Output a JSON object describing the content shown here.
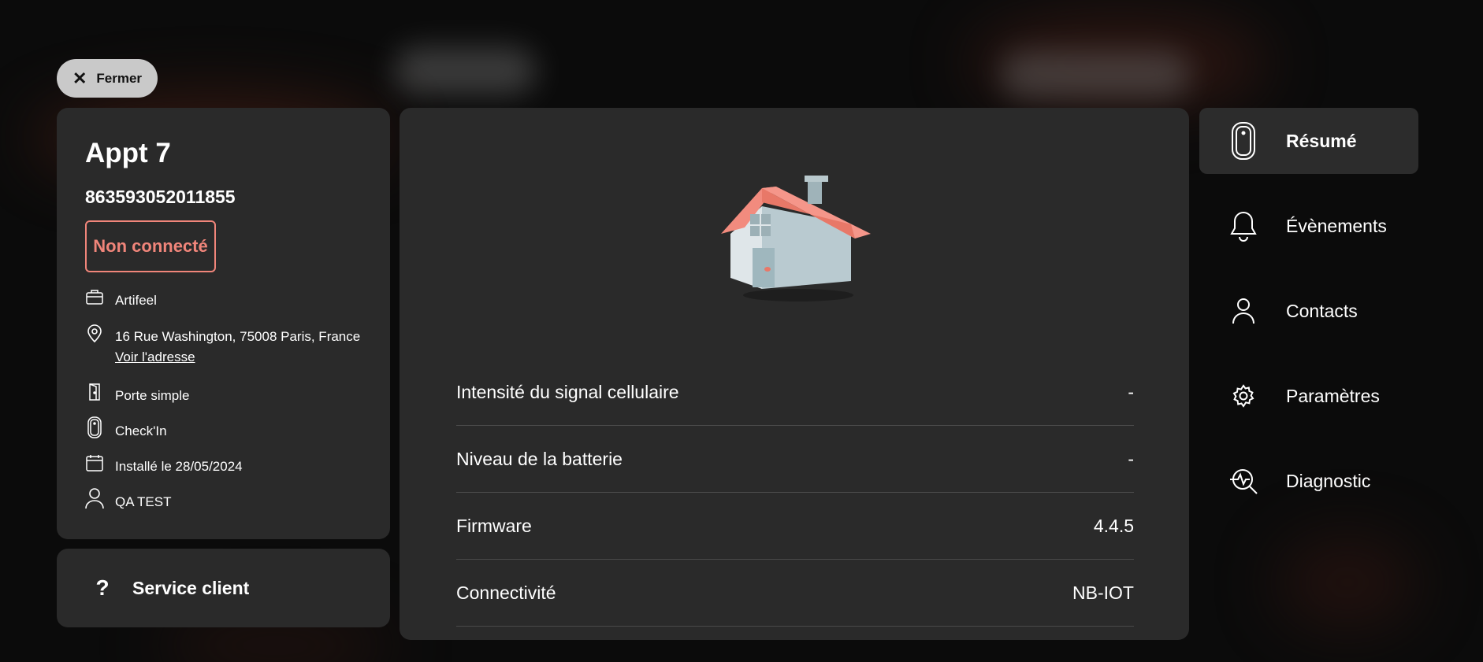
{
  "close_button": {
    "label": "Fermer",
    "icon": "close-icon"
  },
  "device": {
    "name": "Appt 7",
    "serial": "863593052011855",
    "status": "Non connecté",
    "status_color": "#f0857a",
    "details": {
      "company": "Artifeel",
      "address": "16 Rue Washington, 75008 Paris, France",
      "address_link": "Voir l'adresse",
      "door_type": "Porte simple",
      "product": "Check'In",
      "installed": "Installé le 28/05/2024",
      "installer": "QA TEST"
    }
  },
  "support": {
    "icon": "?",
    "label": "Service client"
  },
  "properties": [
    {
      "label": "Intensité du signal cellulaire",
      "value": "-"
    },
    {
      "label": "Niveau de la batterie",
      "value": "-"
    },
    {
      "label": "Firmware",
      "value": "4.4.5"
    },
    {
      "label": "Connectivité",
      "value": "NB-IOT"
    }
  ],
  "nav": [
    {
      "label": "Résumé",
      "icon": "device-icon",
      "active": true
    },
    {
      "label": "Évènements",
      "icon": "bell-icon"
    },
    {
      "label": "Contacts",
      "icon": "user-icon"
    },
    {
      "label": "Paramètres",
      "icon": "gear-icon"
    },
    {
      "label": "Diagnostic",
      "icon": "diagnostic-icon"
    }
  ]
}
